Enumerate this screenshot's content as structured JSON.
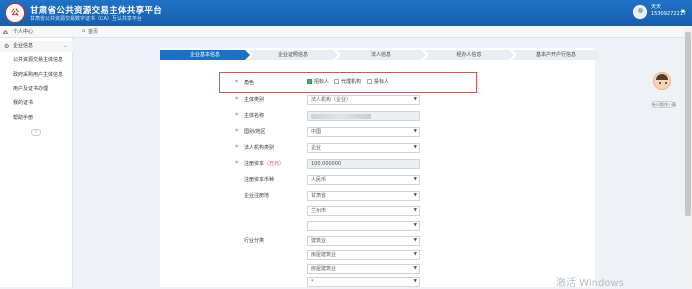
{
  "header": {
    "logo_text": "公",
    "title": "甘肃省公共资源交易主体共享平台",
    "subtitle": "甘肃省公共资源交易数字证书（CA）互认共享平台",
    "user_name": "天天",
    "user_phone": "15309272217"
  },
  "breadcrumb": {
    "current": "首页"
  },
  "sidebar": {
    "items": [
      {
        "label": "个人中心",
        "icon": "home-icon"
      },
      {
        "label": "企业信息",
        "icon": "gear-icon"
      },
      {
        "label": "公共资源交易主体信息"
      },
      {
        "label": "政府采购用户主体信息"
      },
      {
        "label": "用户及证书办理"
      },
      {
        "label": "我的证书"
      },
      {
        "label": "帮助手册"
      }
    ]
  },
  "steps": [
    "企业基本信息",
    "企业证照信息",
    "法人信息",
    "经办人信息",
    "基本户开户行信息"
  ],
  "form": {
    "role": {
      "label": "角色",
      "options": [
        {
          "label": "招标人",
          "checked": true
        },
        {
          "label": "代理机构",
          "checked": false
        },
        {
          "label": "投标人",
          "checked": false
        }
      ]
    },
    "fields": [
      {
        "label": "主体类别",
        "value": "法人机构（企业）",
        "select": true,
        "required": true
      },
      {
        "label": "主体名称",
        "value": "",
        "disabled": true,
        "required": true
      },
      {
        "label": "国别/地区",
        "value": "中国",
        "select": true,
        "required": true
      },
      {
        "label": "法人机构类别",
        "value": "企业",
        "select": true,
        "required": true
      },
      {
        "label": "注册资本",
        "label_suffix": "（万元）",
        "value": "100.000000",
        "disabled": true,
        "required": true
      },
      {
        "label": "注册资本币种",
        "value": "人民币",
        "select": true,
        "required": false
      },
      {
        "label": "企业注册地",
        "value": "甘肃省",
        "select": true,
        "required": false
      },
      {
        "label": "",
        "value": "兰州市",
        "select": true,
        "required": false
      },
      {
        "label": "",
        "value": "",
        "select": true,
        "required": false
      },
      {
        "label": "行业分类",
        "value": "建筑业",
        "select": true,
        "required": false
      },
      {
        "label": "",
        "value": "房屋建筑业",
        "select": true,
        "required": false
      },
      {
        "label": "",
        "value": "房屋建筑业",
        "select": true,
        "required": false
      },
      {
        "label": "",
        "value": "*",
        "select": true,
        "required": false
      }
    ]
  },
  "float_helper": {
    "label": "有问题找小萌"
  },
  "watermark": "激活 Windows",
  "colors": {
    "primary": "#1b72c4",
    "required": "#e4393c",
    "highlight": "#d9534f",
    "check": "#3cb371"
  }
}
